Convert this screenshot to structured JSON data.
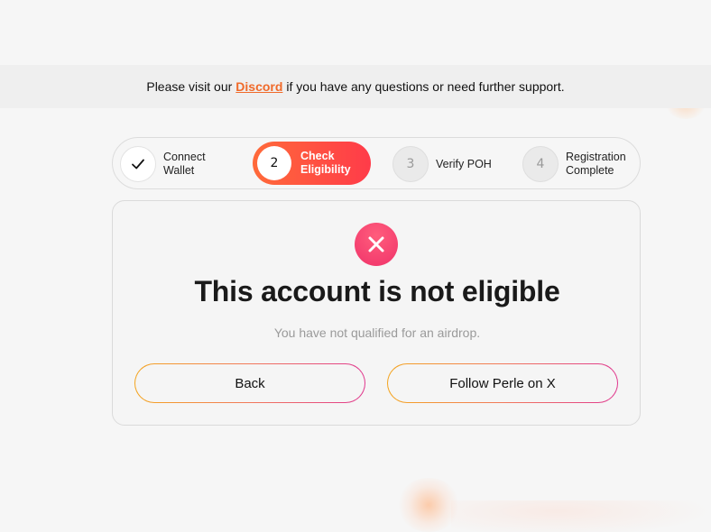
{
  "banner": {
    "text_before": "Please visit our",
    "link_label": "Discord",
    "text_after": "if you have any questions or need further support."
  },
  "stepper": {
    "steps": [
      {
        "marker": "✓",
        "label_line1": "Connect",
        "label_line2": "Wallet",
        "state": "complete"
      },
      {
        "marker": "2",
        "label_line1": "Check",
        "label_line2": "Eligibility",
        "state": "active"
      },
      {
        "marker": "3",
        "label_line1": "Verify POH",
        "label_line2": "",
        "state": "pending"
      },
      {
        "marker": "4",
        "label_line1": "Registration",
        "label_line2": "Complete",
        "state": "pending"
      }
    ]
  },
  "result": {
    "icon": "close-icon",
    "title": "This account is not eligible",
    "subtitle": "You have not qualified for an airdrop.",
    "back_label": "Back",
    "follow_label": "Follow Perle on X"
  },
  "colors": {
    "accent_link": "#f06a2a",
    "active_step_start": "#ff6a3a",
    "active_step_end": "#ff3b49",
    "error_icon": "#f0336a",
    "button_border_start": "#f4a51f",
    "button_border_end": "#e0388f"
  }
}
